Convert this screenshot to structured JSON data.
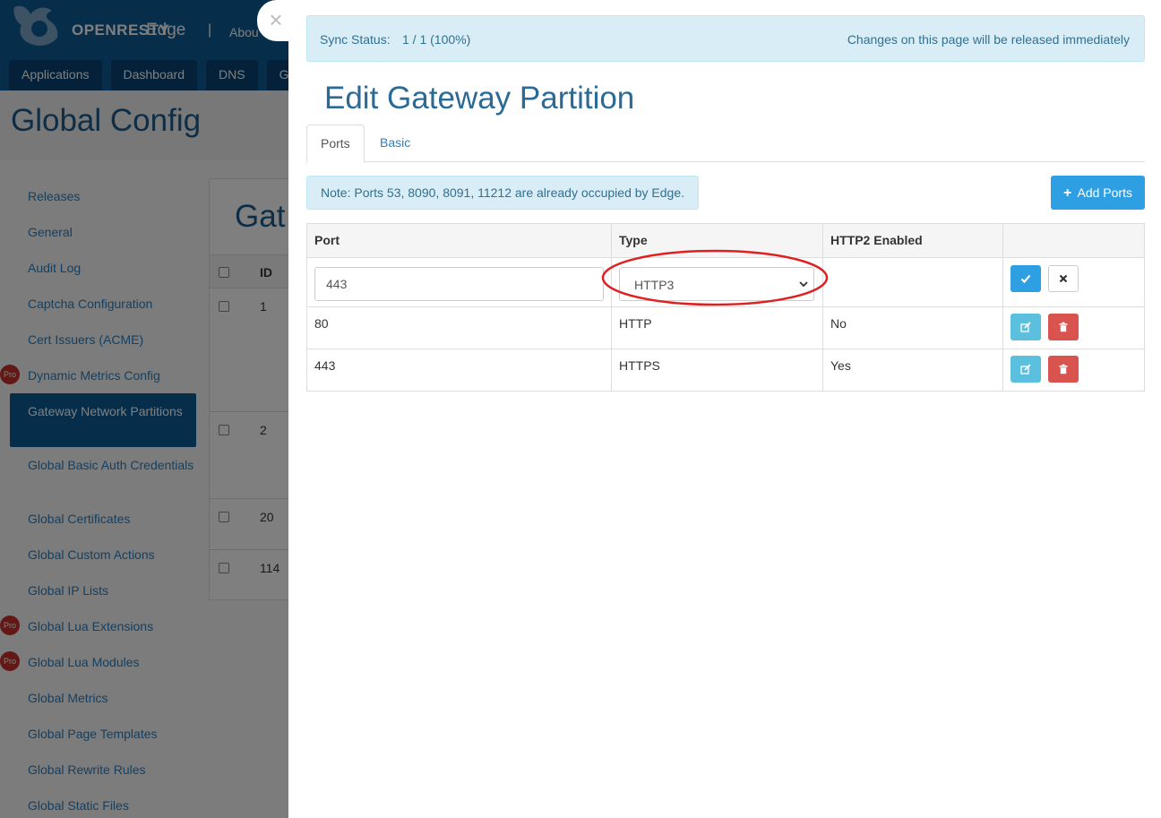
{
  "app": {
    "logo_text": "OPENRESTY",
    "product": "Edge",
    "separator": "|",
    "about_partial": "Abou",
    "nav_tabs": [
      "Applications",
      "Dashboard",
      "DNS",
      "G"
    ],
    "page_title": "Global Config"
  },
  "sidebar": {
    "pro_badge": "Pro",
    "items": [
      {
        "label": "Releases",
        "pro": false
      },
      {
        "label": "General",
        "pro": false
      },
      {
        "label": "Audit Log",
        "pro": false
      },
      {
        "label": "Captcha Configuration",
        "pro": false
      },
      {
        "label": "Cert Issuers (ACME)",
        "pro": false
      },
      {
        "label": "Dynamic Metrics Config",
        "pro": true
      },
      {
        "label": "Gateway Network Partitions",
        "pro": false,
        "active": true
      },
      {
        "label": "Global Basic Auth Credentials",
        "pro": false
      },
      {
        "label": "Global Certificates",
        "pro": false
      },
      {
        "label": "Global Custom Actions",
        "pro": false
      },
      {
        "label": "Global IP Lists",
        "pro": false
      },
      {
        "label": "Global Lua Extensions",
        "pro": true
      },
      {
        "label": "Global Lua Modules",
        "pro": true
      },
      {
        "label": "Global Metrics",
        "pro": false
      },
      {
        "label": "Global Page Templates",
        "pro": false
      },
      {
        "label": "Global Rewrite Rules",
        "pro": false
      },
      {
        "label": "Global Static Files",
        "pro": false
      }
    ]
  },
  "bg_panel": {
    "title_partial": "Gat",
    "id_header": "ID",
    "ids": [
      "1",
      "2",
      "20",
      "114"
    ]
  },
  "drawer": {
    "close_glyph": "×",
    "sync_label": "Sync Status:",
    "sync_value": "1 / 1 (100%)",
    "sync_note": "Changes on this page will be released immediately",
    "title": "Edit Gateway Partition",
    "tabs": {
      "ports": "Ports",
      "basic": "Basic"
    },
    "note": "Note: Ports 53, 8090, 8091, 11212 are already occupied by Edge.",
    "add_button": "Add Ports",
    "table": {
      "headers": {
        "port": "Port",
        "type": "Type",
        "http2": "HTTP2 Enabled"
      },
      "edit_row": {
        "port_value": "443",
        "type_selected": "HTTP3"
      },
      "rows": [
        {
          "port": "80",
          "type": "HTTP",
          "http2": "No"
        },
        {
          "port": "443",
          "type": "HTTPS",
          "http2": "Yes"
        }
      ]
    }
  },
  "colors": {
    "brand_blue": "#0d5c97",
    "primary": "#2e9fe3",
    "info": "#5bc0de",
    "danger": "#d9534f",
    "highlight_ring": "#e02020"
  }
}
